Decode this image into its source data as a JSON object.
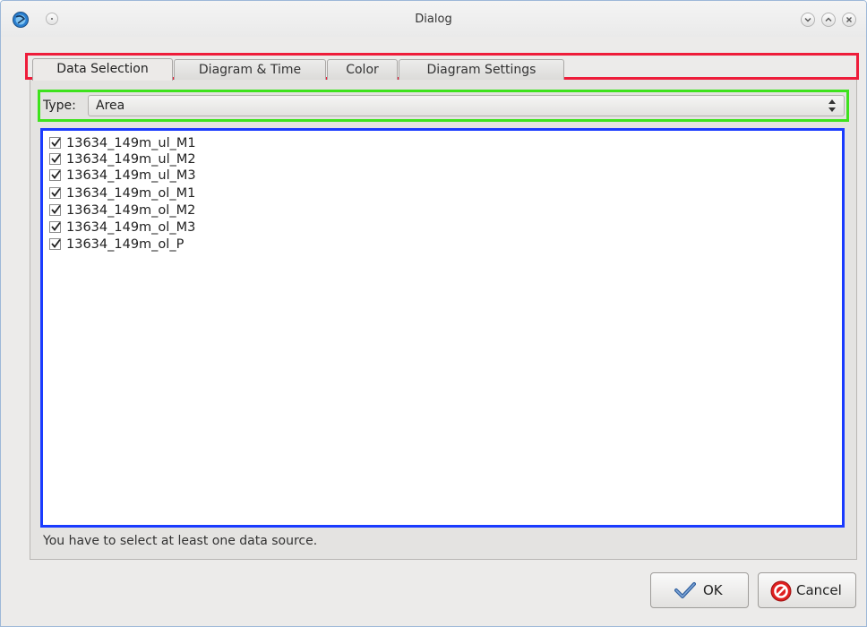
{
  "window": {
    "title": "Dialog"
  },
  "tabs": [
    {
      "label": "Data Selection",
      "active": true
    },
    {
      "label": "Diagram & Time",
      "active": false
    },
    {
      "label": "Color",
      "active": false
    },
    {
      "label": "Diagram Settings",
      "active": false
    }
  ],
  "type_selector": {
    "label": "Type:",
    "value": "Area"
  },
  "data_sources": [
    {
      "label": "13634_149m_ul_M1",
      "checked": true
    },
    {
      "label": "13634_149m_ul_M2",
      "checked": true
    },
    {
      "label": "13634_149m_ul_M3",
      "checked": true
    },
    {
      "label": "13634_149m_ol_M1",
      "checked": true
    },
    {
      "label": "13634_149m_ol_M2",
      "checked": true
    },
    {
      "label": "13634_149m_ol_M3",
      "checked": true
    },
    {
      "label": "13634_149m_ol_P",
      "checked": true
    }
  ],
  "status": {
    "message": "You have to select at least one data source."
  },
  "buttons": {
    "ok_label": "OK",
    "cancel_label": "Cancel"
  },
  "colors": {
    "highlight_tabs": "#ee1c3a",
    "highlight_type": "#3ee21d",
    "highlight_list": "#1a3bff"
  }
}
